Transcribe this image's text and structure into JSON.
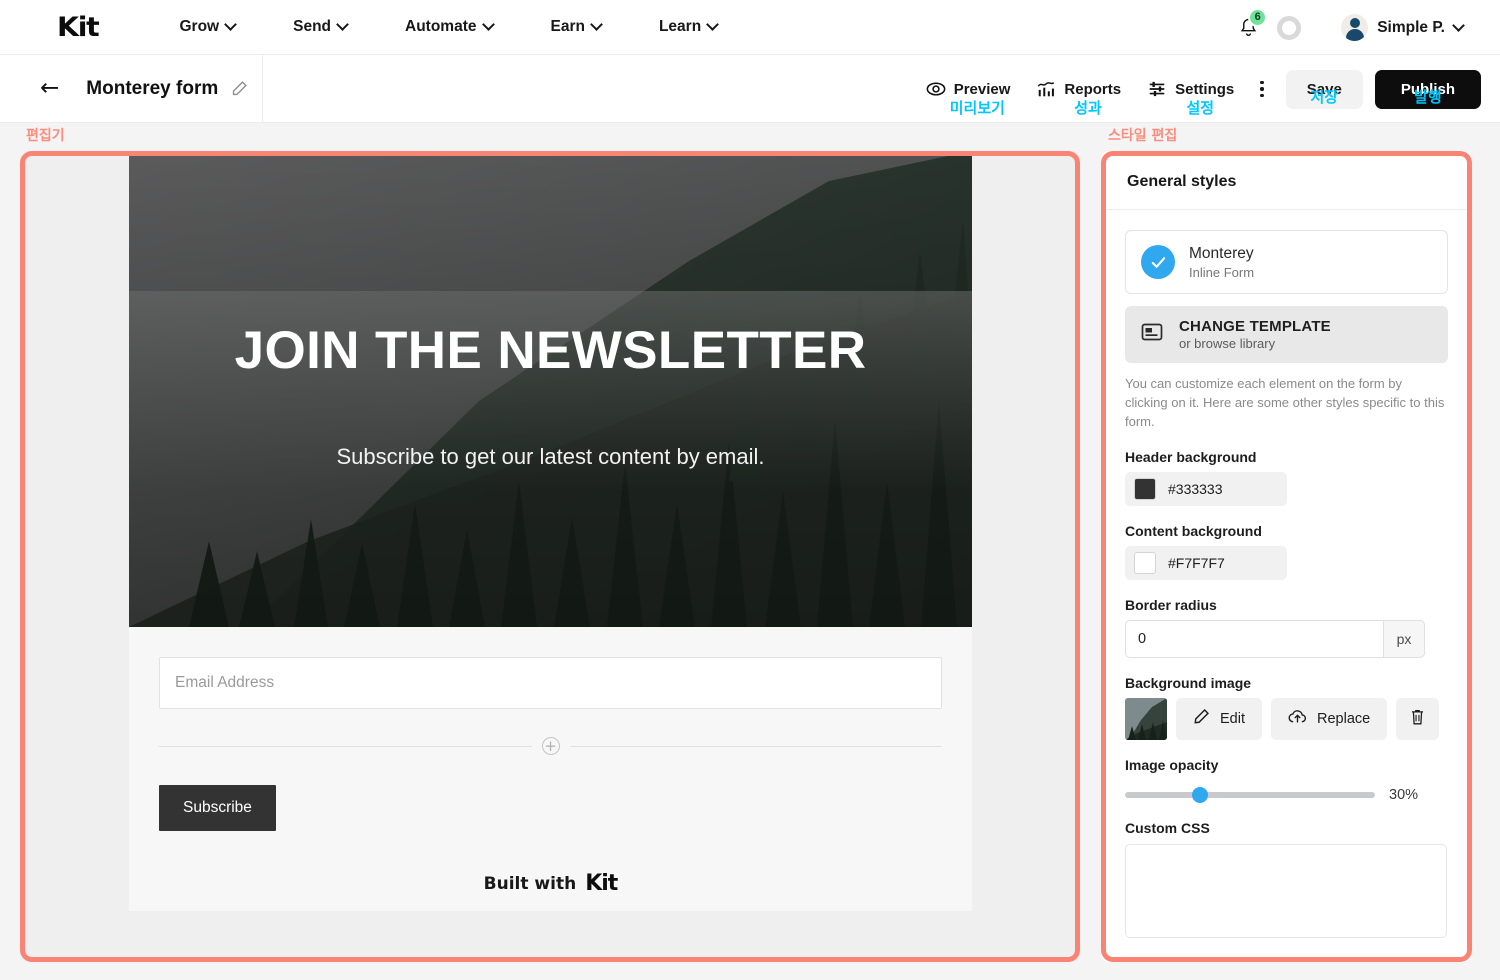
{
  "topnav": {
    "logo": "Kit",
    "items": [
      {
        "label": "Grow",
        "icon": "chevron-down-icon"
      },
      {
        "label": "Send",
        "icon": "chevron-down-icon"
      },
      {
        "label": "Automate",
        "icon": "chevron-down-icon"
      },
      {
        "label": "Earn",
        "icon": "chevron-down-icon"
      },
      {
        "label": "Learn",
        "icon": "chevron-down-icon"
      }
    ],
    "notification_badge": "6",
    "notification_icon": "bell-icon",
    "progress_icon": "progress-ring-icon",
    "account_name": "Simple P.",
    "account_chevron": "chevron-down-icon"
  },
  "subbar": {
    "back_icon": "back-arrow-icon",
    "title": "Monterey form",
    "edit_icon": "pencil-icon",
    "tools": [
      {
        "label": "Preview",
        "kr": "미리보기",
        "icon": "eye-icon"
      },
      {
        "label": "Reports",
        "kr": "성과",
        "icon": "chart-icon"
      },
      {
        "label": "Settings",
        "kr": "설정",
        "icon": "sliders-icon"
      }
    ],
    "more_icon": "kebab-menu-icon",
    "save_label": "Save",
    "save_kr": "저장",
    "publish_label": "Publish",
    "publish_kr": "발행"
  },
  "annotations": {
    "editor": "편집기",
    "style_editor": "스타일 편집",
    "highlight_color": "#F98375",
    "kr_accent_color": "#00C6FF"
  },
  "form_preview": {
    "heading": "JOIN THE NEWSLETTER",
    "subheading": "Subscribe to get our latest content by email.",
    "email_placeholder": "Email Address",
    "email_value": "",
    "add_block_icon": "plus-circle-icon",
    "submit_label": "Subscribe",
    "footer_prefix": "Built with",
    "footer_brand": "Kit",
    "header_bg": "#333333",
    "content_bg": "#F7F7F7"
  },
  "style_panel": {
    "title": "General styles",
    "template": {
      "name": "Monterey",
      "type": "Inline Form",
      "selected_icon": "check-circle-icon",
      "accent": "#2FA8F0"
    },
    "change_template": {
      "title": "CHANGE TEMPLATE",
      "subtitle": "or browse library",
      "icon": "template-icon"
    },
    "hint": "You can customize each element on the form by clicking on it. Here are some other styles specific to this form.",
    "fields": {
      "header_background_label": "Header background",
      "header_background_value": "#333333",
      "content_background_label": "Content background",
      "content_background_value": "#F7F7F7",
      "border_radius_label": "Border radius",
      "border_radius_value": "0",
      "border_radius_unit": "px",
      "background_image_label": "Background image",
      "edit_label": "Edit",
      "edit_icon": "pencil-icon",
      "replace_label": "Replace",
      "replace_icon": "cloud-upload-icon",
      "delete_icon": "trash-icon",
      "image_opacity_label": "Image opacity",
      "image_opacity_value": "30%",
      "image_opacity_percent": 30,
      "custom_css_label": "Custom CSS",
      "custom_css_value": ""
    }
  }
}
